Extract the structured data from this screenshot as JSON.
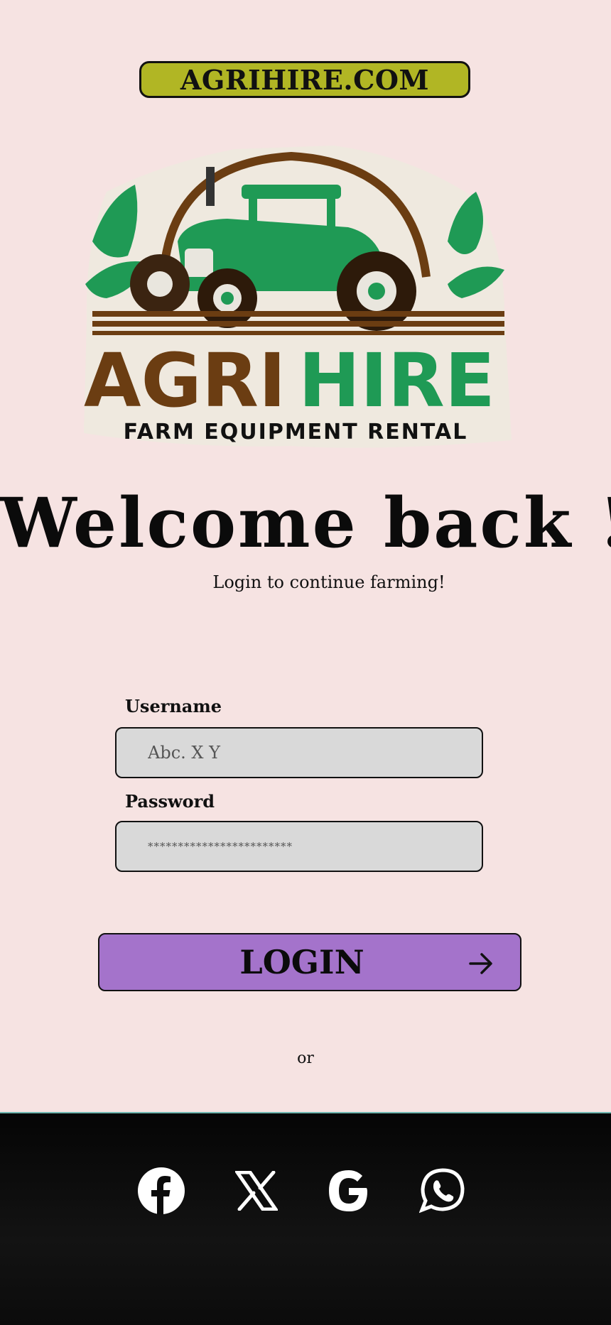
{
  "header": {
    "site_name": "AGRIHIRE.COM"
  },
  "logo": {
    "brand_part1": "AGRI",
    "brand_part2": "HIRE",
    "tagline": "FARM EQUIPMENT RENTAL"
  },
  "welcome": {
    "title": "Welcome back !",
    "subtitle": "Login to continue farming!"
  },
  "form": {
    "username_label": "Username",
    "username_placeholder": "Abc. X Y",
    "password_label": "Password",
    "password_placeholder": "************************",
    "login_label": "LOGIN"
  },
  "divider": {
    "or_text": "or"
  },
  "social": [
    {
      "name": "facebook-icon"
    },
    {
      "name": "x-icon"
    },
    {
      "name": "google-icon"
    },
    {
      "name": "whatsapp-icon"
    }
  ],
  "colors": {
    "background": "#f6e3e2",
    "pill": "#b1b624",
    "button": "#a473cb",
    "footer": "#0b0b0b",
    "brand_green": "#1f9a55",
    "brand_brown": "#6b3d12"
  }
}
